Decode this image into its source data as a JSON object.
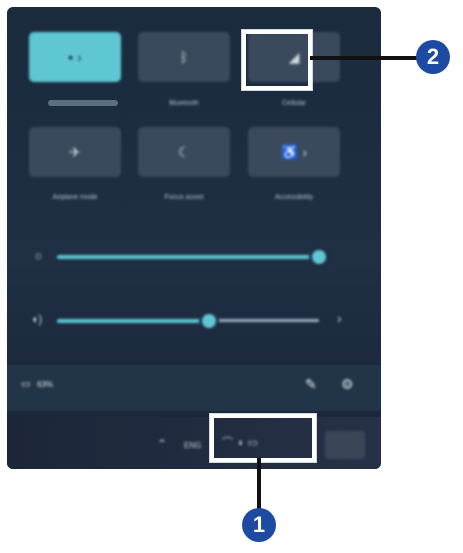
{
  "quick_settings": {
    "tiles_row1": [
      {
        "label": "",
        "state": "on",
        "icon": "wifi-icon"
      },
      {
        "label": "Bluetooth",
        "state": "off",
        "icon": "bluetooth-icon"
      },
      {
        "label": "Cellular",
        "state": "off",
        "icon": "cellular-icon"
      }
    ],
    "tiles_row2": [
      {
        "label": "Airplane mode",
        "state": "off",
        "icon": "airplane-icon"
      },
      {
        "label": "Focus assist",
        "state": "off",
        "icon": "moon-icon"
      },
      {
        "label": "Accessibility",
        "state": "off",
        "icon": "accessibility-icon"
      }
    ],
    "brightness_level": 1.0,
    "volume_level": 0.58,
    "battery_text": "63%"
  },
  "taskbar": {
    "language": "ENG"
  },
  "callouts": {
    "badge1": "1",
    "badge2": "2"
  },
  "colors": {
    "accent": "#5ec7d3",
    "badge": "#1d4aa3"
  }
}
